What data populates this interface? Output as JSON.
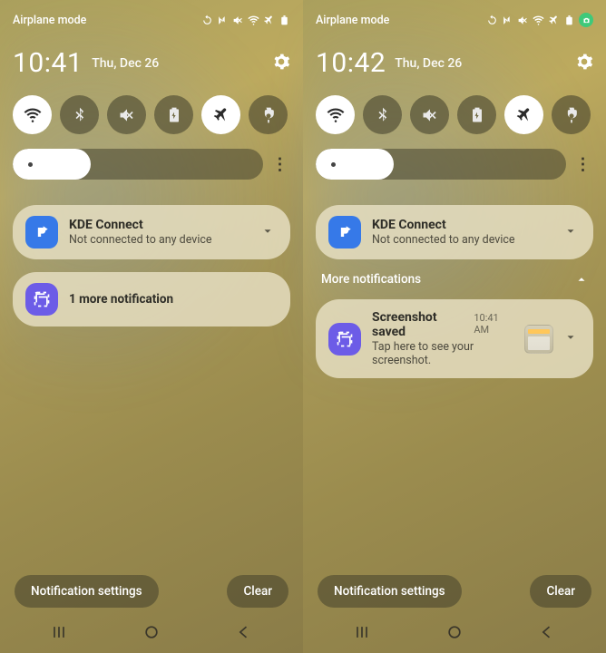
{
  "left": {
    "status_text": "Airplane mode",
    "clock": "10:41",
    "date": "Thu, Dec 26",
    "toggles": [
      {
        "name": "wifi",
        "on": true
      },
      {
        "name": "bluetooth",
        "on": false
      },
      {
        "name": "mute",
        "on": false
      },
      {
        "name": "battery-saver",
        "on": false
      },
      {
        "name": "airplane",
        "on": true
      },
      {
        "name": "flashlight",
        "on": false
      }
    ],
    "notifications": [
      {
        "app": "KDE Connect",
        "sub": "Not connected to any device",
        "icon": "blue"
      },
      {
        "summary": "1 more notification",
        "icon": "purple"
      }
    ],
    "footer": {
      "settings": "Notification settings",
      "clear": "Clear"
    }
  },
  "right": {
    "status_text": "Airplane mode",
    "clock": "10:42",
    "date": "Thu, Dec 26",
    "toggles": [
      {
        "name": "wifi",
        "on": true
      },
      {
        "name": "bluetooth",
        "on": false
      },
      {
        "name": "mute",
        "on": false
      },
      {
        "name": "battery-saver",
        "on": false
      },
      {
        "name": "airplane",
        "on": true
      },
      {
        "name": "flashlight",
        "on": false
      }
    ],
    "section_header": "More notifications",
    "notifications": [
      {
        "app": "KDE Connect",
        "sub": "Not connected to any device",
        "icon": "blue"
      },
      {
        "app": "Screenshot saved",
        "time": "10:41 AM",
        "sub": "Tap here to see your screenshot.",
        "icon": "purple",
        "thumb": true
      }
    ],
    "footer": {
      "settings": "Notification settings",
      "clear": "Clear"
    }
  }
}
